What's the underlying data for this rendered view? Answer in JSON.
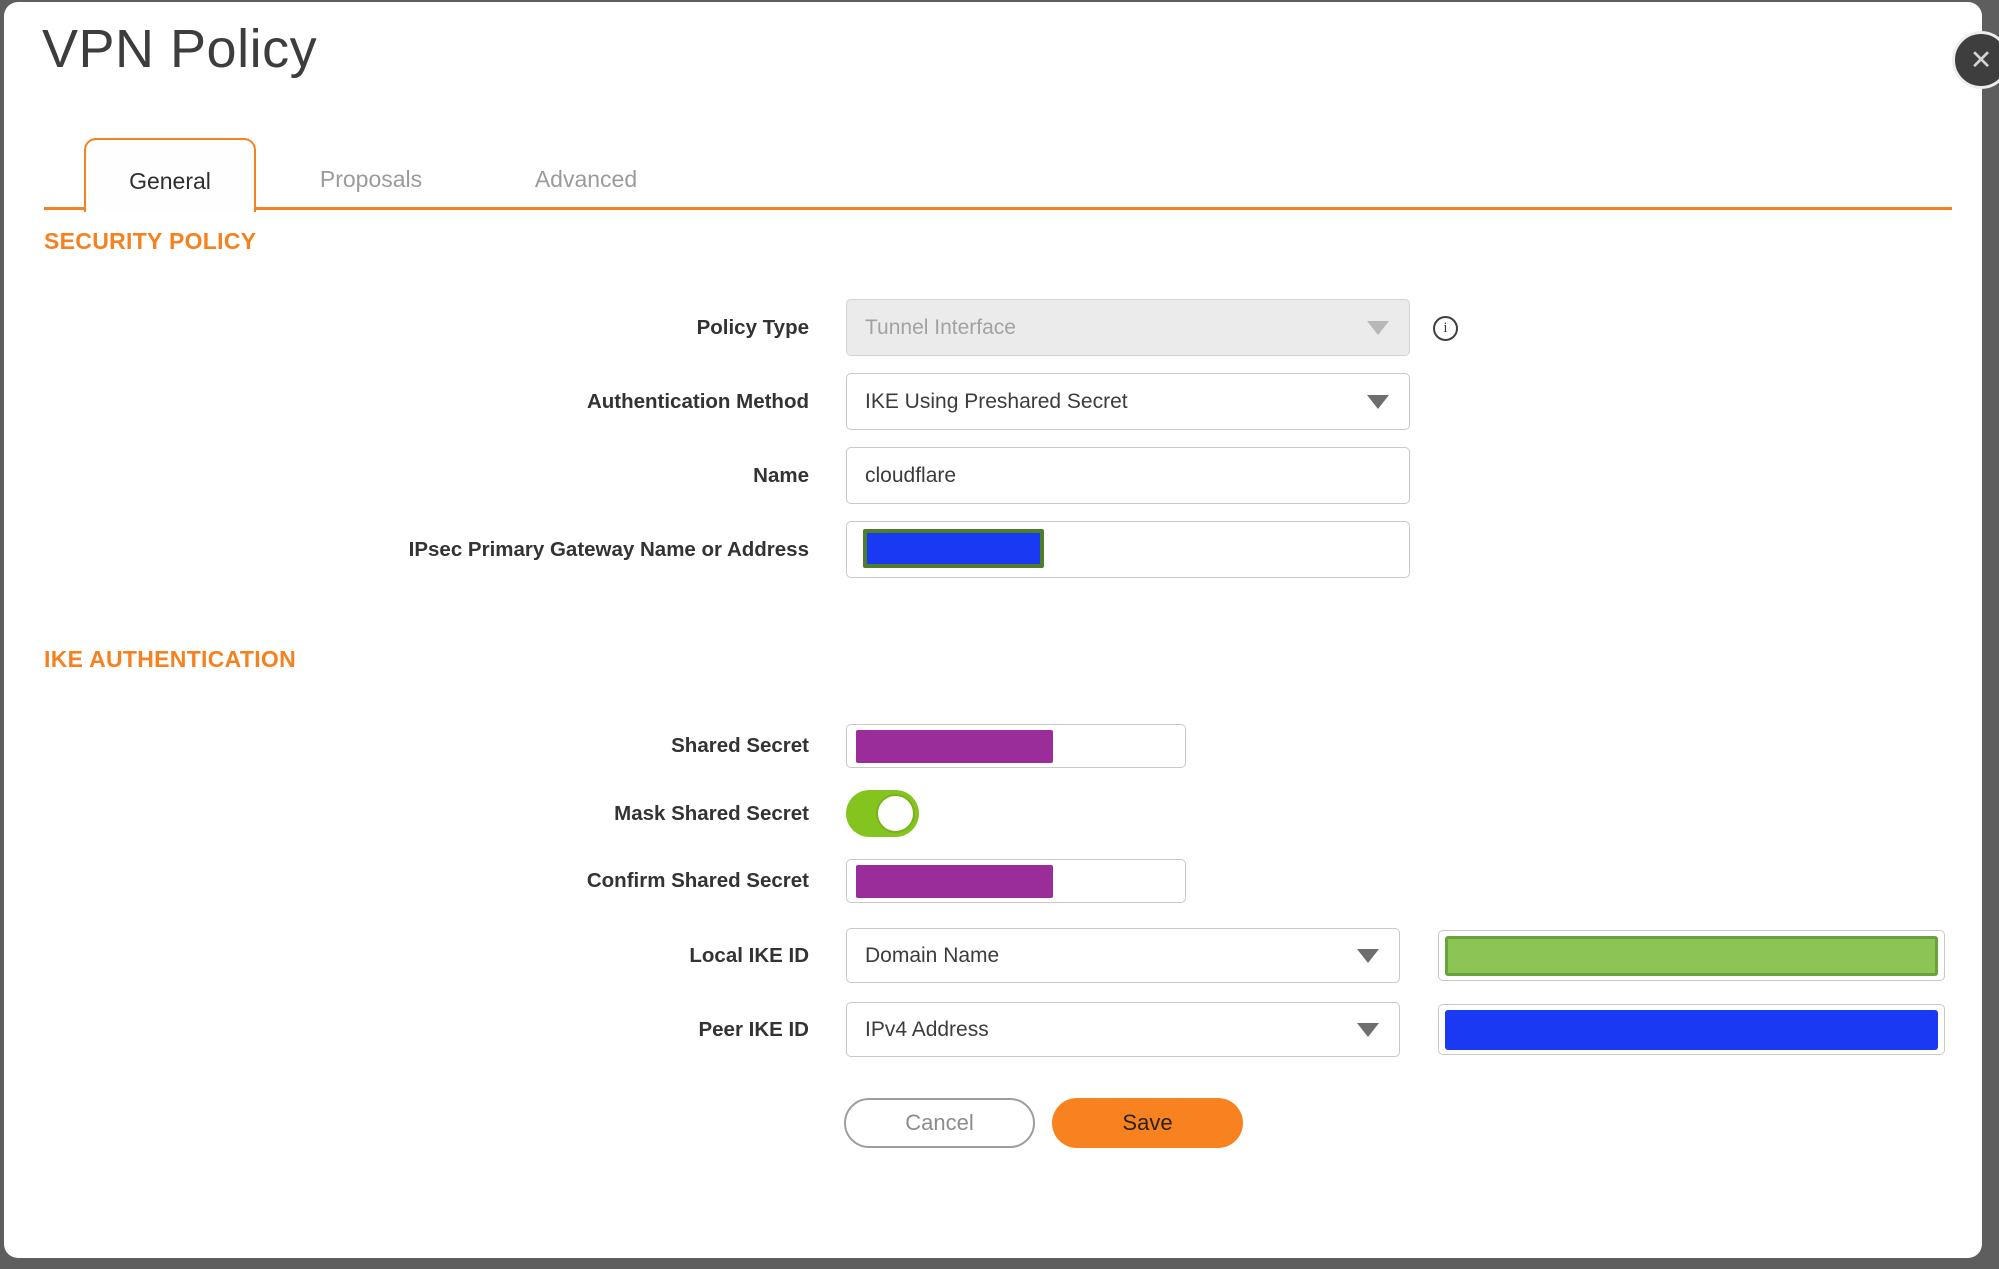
{
  "dialog": {
    "title": "VPN Policy"
  },
  "icons": {
    "close": "✕",
    "info": "i"
  },
  "tabs": [
    {
      "label": "General",
      "active": true
    },
    {
      "label": "Proposals",
      "active": false
    },
    {
      "label": "Advanced",
      "active": false
    }
  ],
  "sections": {
    "security_policy": "SECURITY POLICY",
    "ike_authentication": "IKE AUTHENTICATION"
  },
  "fields": {
    "policy_type": {
      "label": "Policy Type",
      "value": "Tunnel Interface",
      "disabled": true
    },
    "authentication_method": {
      "label": "Authentication Method",
      "value": "IKE Using Preshared Secret"
    },
    "name": {
      "label": "Name",
      "value": "cloudflare"
    },
    "gateway": {
      "label": "IPsec Primary Gateway Name or Address",
      "value": "",
      "redacted": "blue"
    },
    "shared_secret": {
      "label": "Shared Secret",
      "value": "",
      "redacted": "purple"
    },
    "mask_shared_secret": {
      "label": "Mask Shared Secret",
      "state": "on"
    },
    "confirm_shared_secret": {
      "label": "Confirm Shared Secret",
      "value": "",
      "redacted": "purple"
    },
    "local_ike_id": {
      "label": "Local IKE ID",
      "type_value": "Domain Name",
      "id_value": "",
      "redacted": "green"
    },
    "peer_ike_id": {
      "label": "Peer IKE ID",
      "type_value": "IPv4 Address",
      "id_value": "",
      "redacted": "blue"
    }
  },
  "buttons": {
    "cancel": "Cancel",
    "save": "Save"
  },
  "colors": {
    "accent_orange": "#F5821F",
    "save_button": "#F8821F",
    "toggle_green": "#85C41E",
    "redaction_purple": "#9B2D9B",
    "redaction_blue": "#1A39F2",
    "redaction_green_fill": "#8CC456",
    "redaction_green_border": "#69A33B",
    "redaction_olive_border": "#4E7D2B",
    "backdrop_gray": "#5E5E5E"
  }
}
